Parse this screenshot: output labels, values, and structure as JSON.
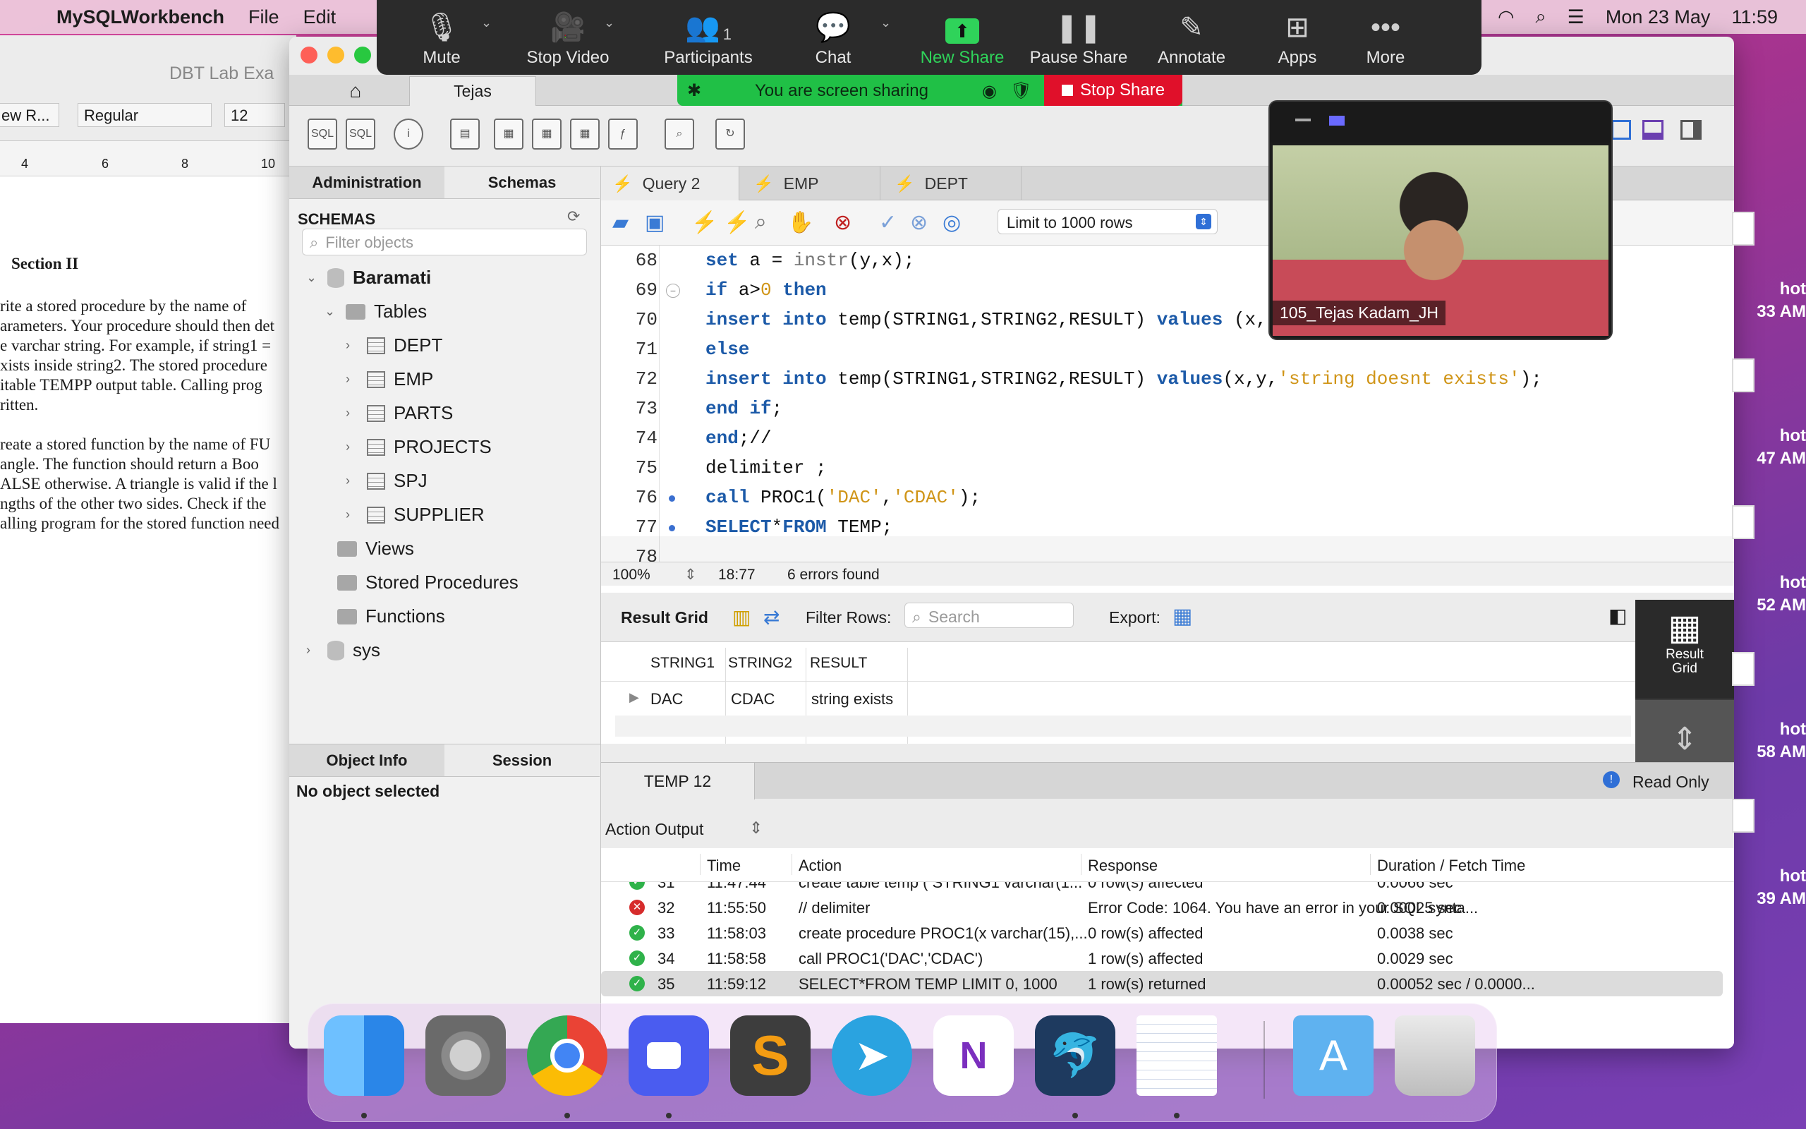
{
  "menubar": {
    "app": "MySQLWorkbench",
    "file": "File",
    "edit": "Edit",
    "date": "Mon 23 May",
    "time": "11:59"
  },
  "zoom": {
    "items": [
      {
        "label": "Mute"
      },
      {
        "label": "Stop Video"
      },
      {
        "label": "Participants",
        "count": "1"
      },
      {
        "label": "Chat"
      },
      {
        "label": "New Share"
      },
      {
        "label": "Pause Share"
      },
      {
        "label": "Annotate"
      },
      {
        "label": "Apps"
      },
      {
        "label": "More"
      }
    ],
    "sharing_text": "You are screen sharing",
    "stop_share": "Stop Share"
  },
  "doc": {
    "title": "DBT Lab Exa",
    "font_style": "Regular",
    "font_size": "12",
    "style_box": "ew R...",
    "ruler": [
      "4",
      "6",
      "8",
      "10"
    ],
    "section": "Section II",
    "lines": [
      "rite a stored procedure by the name of",
      "arameters. Your procedure should then det",
      "e varchar string. For example, if string1 =",
      "xists inside string2.  The stored procedure",
      "itable TEMPP output table. Calling prog",
      "ritten.",
      "",
      "reate a stored function by the name of FU",
      "angle. The function should return a Boo",
      "ALSE otherwise. A triangle is valid if the l",
      "ngths of the other two sides. Check if the",
      "alling program for the stored function need"
    ]
  },
  "wb": {
    "home_tab": "Tejas",
    "panel_tabs": [
      "Administration",
      "Schemas"
    ],
    "schemas_title": "SCHEMAS",
    "filter_placeholder": "Filter objects",
    "tree": {
      "db": "Baramati",
      "tables": "Tables",
      "table_items": [
        "DEPT",
        "EMP",
        "PARTS",
        "PROJECTS",
        "SPJ",
        "SUPPLIER"
      ],
      "views": "Views",
      "procs": "Stored Procedures",
      "funcs": "Functions",
      "sys": "sys"
    },
    "info_tabs": [
      "Object Info",
      "Session"
    ],
    "no_object": "No object selected",
    "query_tabs": [
      "Query 2",
      "EMP",
      "DEPT"
    ],
    "limit": "Limit to 1000 rows",
    "code_lines": [
      {
        "n": "68",
        "html": "<span class='kw'>set</span> a = <span class='fn'>instr</span>(y,x);"
      },
      {
        "n": "69",
        "html": "<span class='kw'>if</span> a><span class='num'>0</span> <span class='kw'>then</span>"
      },
      {
        "n": "70",
        "html": "<span class='kw'>insert into</span> temp(STRING1,STRING2,RESULT) <span class='kw'>values</span> (x,"
      },
      {
        "n": "71",
        "html": "<span class='kw'>else</span>"
      },
      {
        "n": "72",
        "html": "<span class='kw'>insert into</span> temp(STRING1,STRING2,RESULT) <span class='kw'>values</span>(x,y,<span class='str'>'string doesnt exists'</span>);"
      },
      {
        "n": "73",
        "html": "<span class='kw'>end if</span>;"
      },
      {
        "n": "74",
        "html": "<span class='kw'>end</span>;//"
      },
      {
        "n": "75",
        "html": "delimiter ;"
      },
      {
        "n": "76",
        "html": "<span class='kw'>call</span> PROC1(<span class='str'>'DAC'</span>,<span class='str'>'CDAC'</span>);"
      },
      {
        "n": "77",
        "html": "<span class='kw'>SELECT</span>*<span class='kw'>FROM</span> TEMP;"
      },
      {
        "n": "78",
        "html": ""
      }
    ],
    "status": {
      "zoom": "100%",
      "pos": "18:77",
      "errors": "6 errors found"
    },
    "result": {
      "title": "Result Grid",
      "filter_label": "Filter Rows:",
      "search_placeholder": "Search",
      "export": "Export:",
      "columns": [
        "STRING1",
        "STRING2",
        "RESULT"
      ],
      "rows": [
        [
          "DAC",
          "CDAC",
          "string exists"
        ]
      ],
      "side_label": "Result Grid"
    },
    "temp_tab": "TEMP 12",
    "read_only": "Read Only",
    "action_output": "Action Output",
    "ao_columns": [
      "Time",
      "Action",
      "Response",
      "Duration / Fetch Time"
    ],
    "ao_rows": [
      {
        "num": "31",
        "time": "11:47:44",
        "action": "create table temp ( STRING1 varchar(1...",
        "response": "0 row(s) affected",
        "dur": "0.0066 sec",
        "status": "ok"
      },
      {
        "num": "32",
        "time": "11:55:50",
        "action": "// delimiter",
        "response": "Error Code: 1064. You have an error in your SQL synta...",
        "dur": "0.00025 sec",
        "status": "err"
      },
      {
        "num": "33",
        "time": "11:58:03",
        "action": "create procedure PROC1(x varchar(15),...",
        "response": "0 row(s) affected",
        "dur": "0.0038 sec",
        "status": "ok"
      },
      {
        "num": "34",
        "time": "11:58:58",
        "action": "call PROC1('DAC','CDAC')",
        "response": "1 row(s) affected",
        "dur": "0.0029 sec",
        "status": "ok"
      },
      {
        "num": "35",
        "time": "11:59:12",
        "action": "SELECT*FROM TEMP LIMIT 0, 1000",
        "response": "1 row(s) returned",
        "dur": "0.00052 sec / 0.0000...",
        "status": "ok"
      }
    ]
  },
  "video": {
    "name": "105_Tejas Kadam_JH"
  },
  "screenshots": [
    {
      "l1": "hot",
      "l2": "33 AM"
    },
    {
      "l1": "hot",
      "l2": "47 AM"
    },
    {
      "l1": "hot",
      "l2": "52 AM"
    },
    {
      "l1": "hot",
      "l2": "58 AM"
    },
    {
      "l1": "hot",
      "l2": "39 AM"
    }
  ],
  "dock": [
    "Finder",
    "System Preferences",
    "Chrome",
    "Zoom",
    "Sublime Text",
    "Telegram",
    "OneNote",
    "MySQL Workbench",
    "TextEdit",
    "Applications",
    "Trash"
  ],
  "colors": {
    "accent": "#1c5aa8",
    "share_green": "#20c046",
    "stop_red": "#e0102a"
  }
}
